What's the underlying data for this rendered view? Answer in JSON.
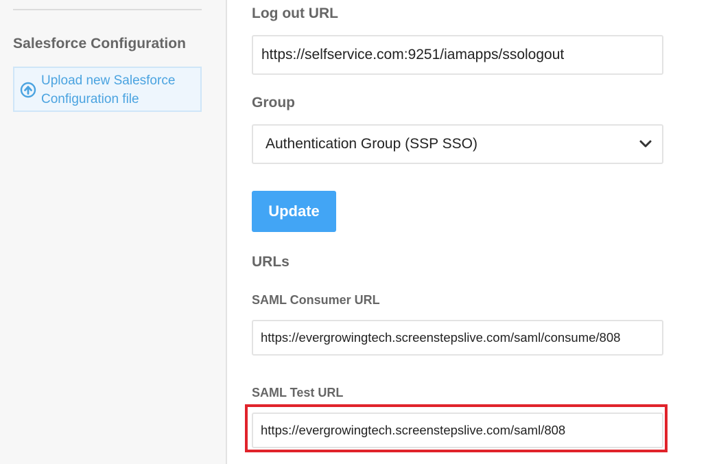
{
  "sidebar": {
    "heading": "Salesforce Configuration",
    "upload_label": "Upload new Salesforce Configuration file",
    "upload_icon": "upload-circle-arrow-icon",
    "accent_color": "#4aa3e0"
  },
  "form": {
    "logout_url_label": "Log out URL",
    "logout_url_value": "https://selfservice.com:9251/iamapps/ssologout",
    "group_label": "Group",
    "group_selected": "Authentication Group (SSP SSO)",
    "update_button": "Update",
    "update_button_color": "#42a5f5"
  },
  "urls": {
    "heading": "URLs",
    "saml_consumer_label": "SAML Consumer URL",
    "saml_consumer_value": "https://evergrowingtech.screenstepslive.com/saml/consume/808",
    "saml_test_label": "SAML Test URL",
    "saml_test_value": "https://evergrowingtech.screenstepslive.com/saml/808",
    "highlight_color": "#e0232b"
  }
}
